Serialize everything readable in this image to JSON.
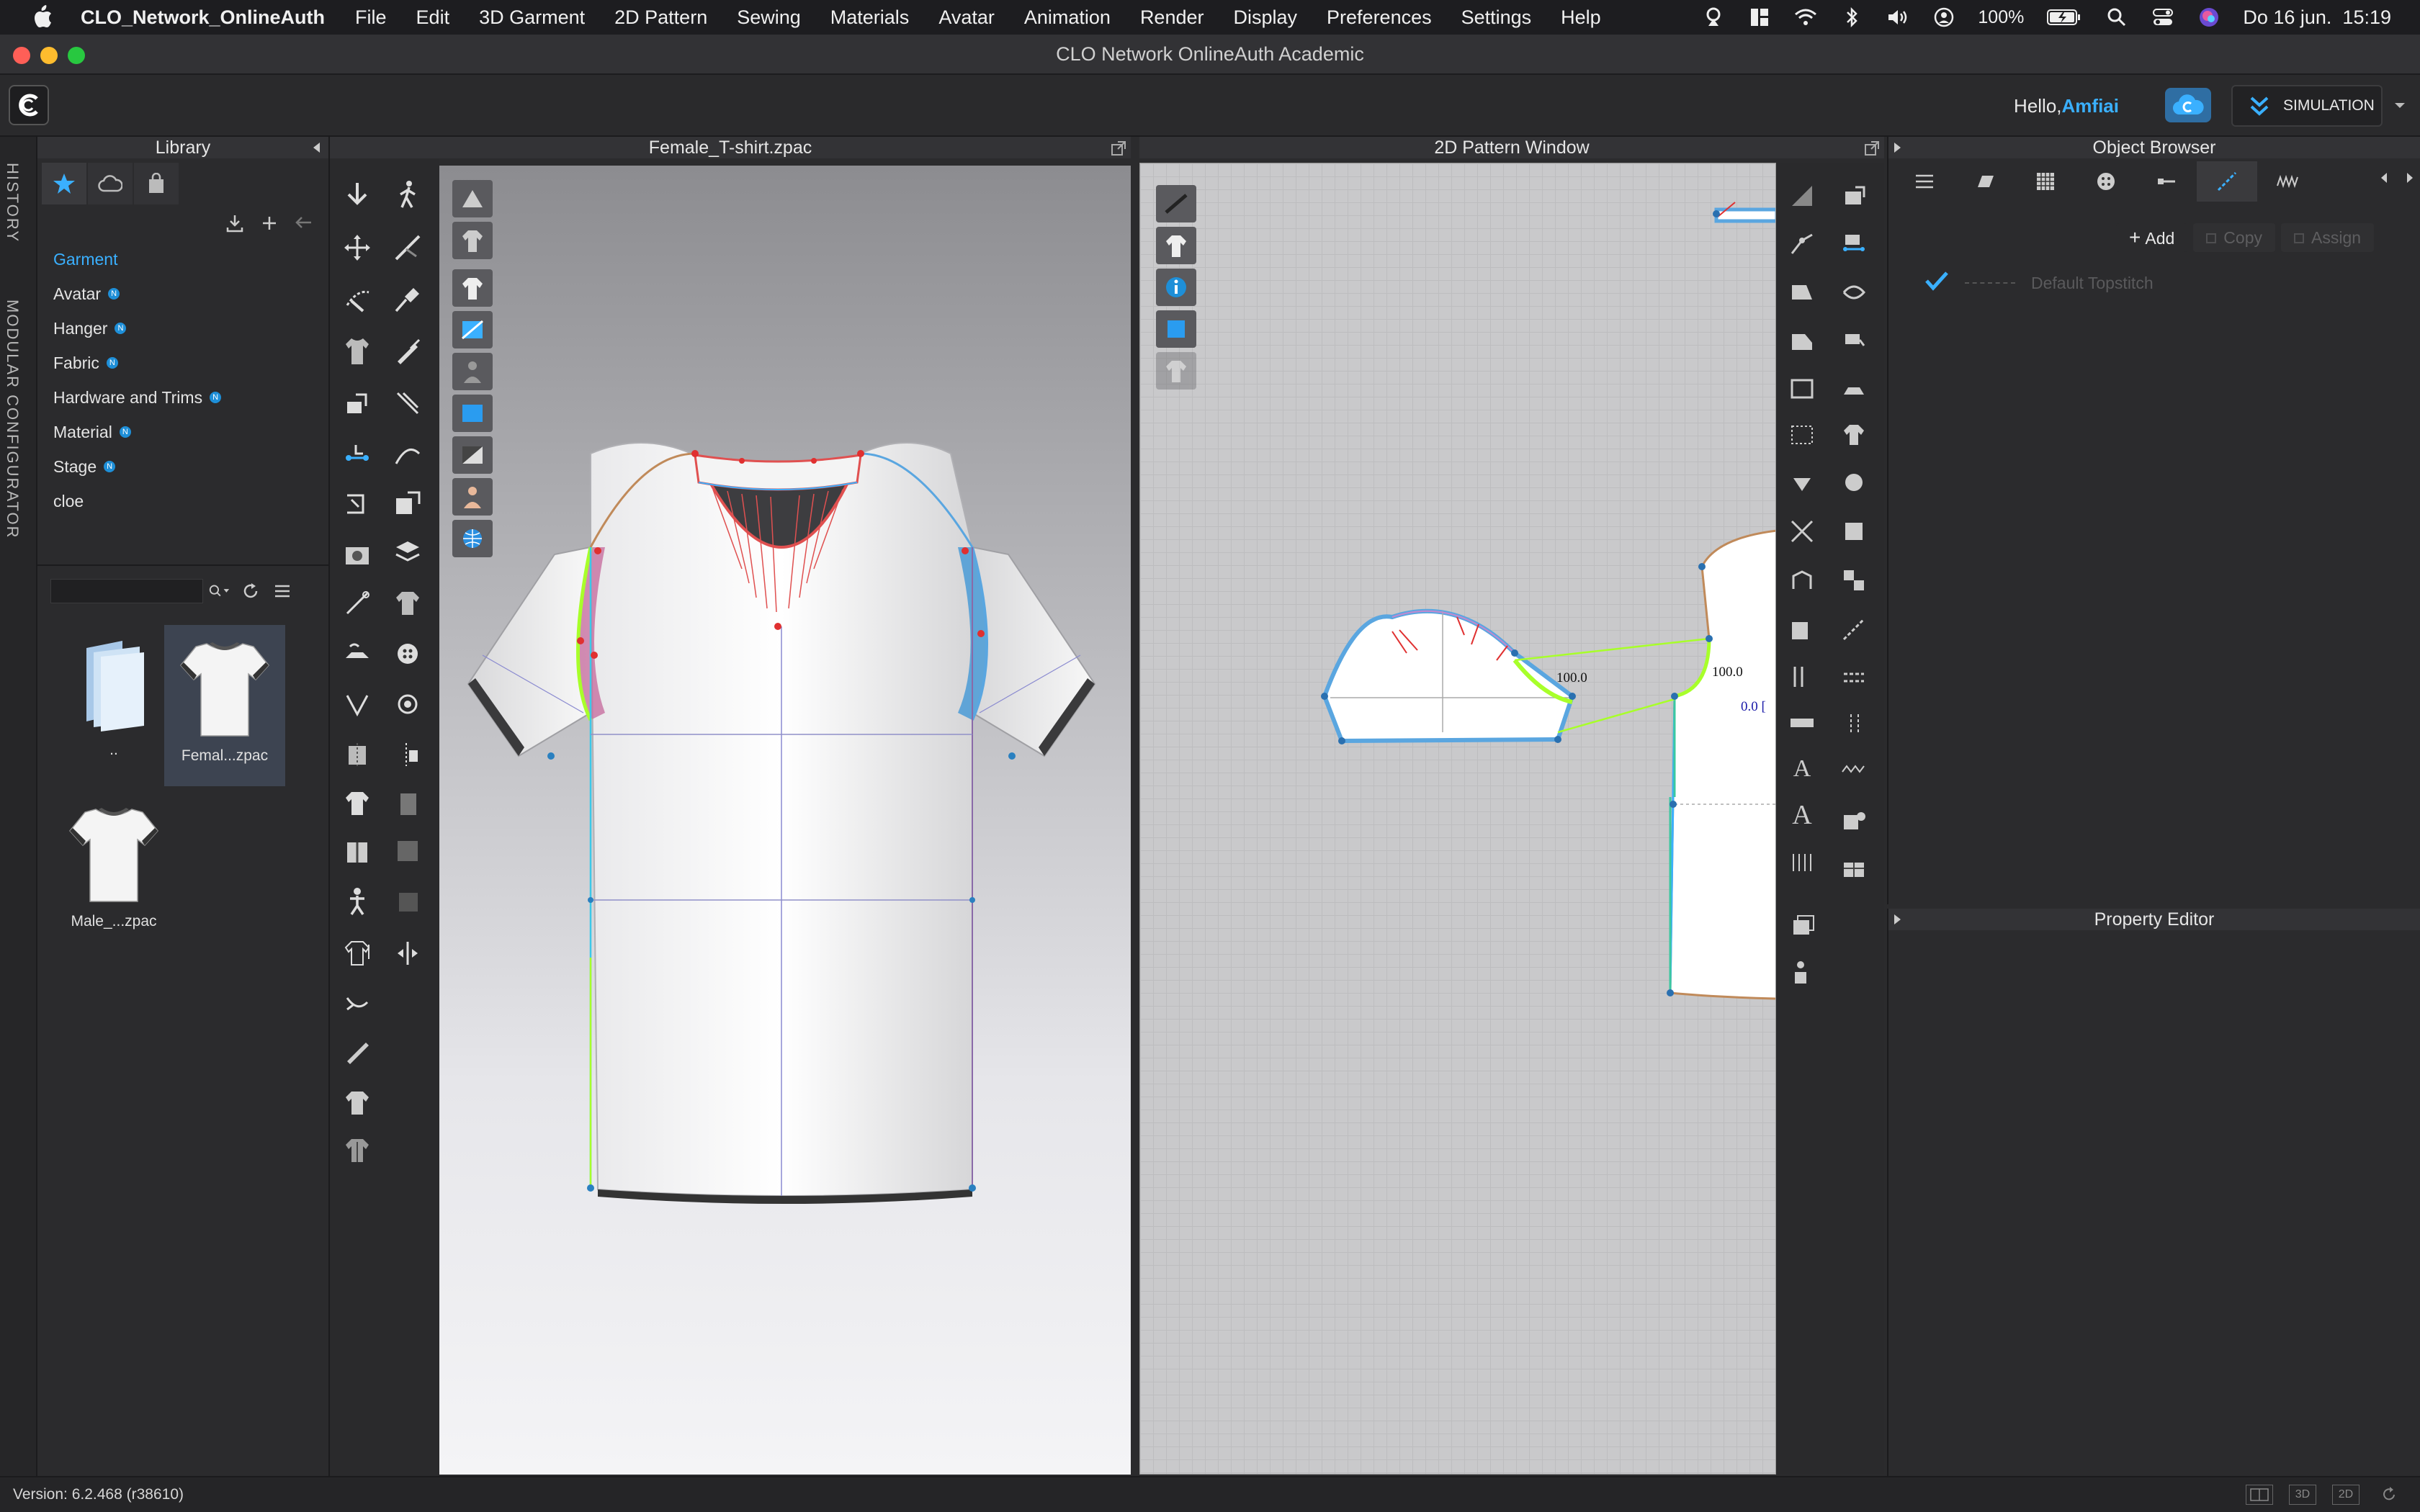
{
  "menubar": {
    "app_name": "CLO_Network_OnlineAuth",
    "items": [
      "File",
      "Edit",
      "3D Garment",
      "2D Pattern",
      "Sewing",
      "Materials",
      "Avatar",
      "Animation",
      "Render",
      "Display",
      "Preferences",
      "Settings",
      "Help"
    ],
    "battery": "100%",
    "datetime": "Do 16 jun.  15:19"
  },
  "window": {
    "title": "CLO Network OnlineAuth Academic"
  },
  "toolbar": {
    "hello_prefix": "Hello,",
    "username": "Amfiai",
    "simulation_label": "SIMULATION"
  },
  "sidetabs": {
    "history": "HISTORY",
    "modular": "MODULAR CONFIGURATOR"
  },
  "library": {
    "title": "Library",
    "items": [
      {
        "label": "Garment",
        "active": true
      },
      {
        "label": "Avatar",
        "badge": "N"
      },
      {
        "label": "Hanger",
        "badge": "N"
      },
      {
        "label": "Fabric",
        "badge": "N"
      },
      {
        "label": "Hardware and Trims",
        "badge": "N"
      },
      {
        "label": "Material",
        "badge": "N"
      },
      {
        "label": "Stage",
        "badge": "N"
      },
      {
        "label": "cloe"
      }
    ],
    "files": [
      {
        "caption": ".."
      },
      {
        "caption": "Femal...zpac",
        "selected": true
      },
      {
        "caption": "Male_...zpac"
      }
    ]
  },
  "window3d": {
    "title": "Female_T-shirt.zpac"
  },
  "window2d": {
    "title": "2D Pattern Window",
    "measure_a": "100.0",
    "measure_b": "100.0",
    "measure_c": "0.0 ["
  },
  "object_browser": {
    "title": "Object Browser",
    "add_label": "Add",
    "copy_label": "Copy",
    "assign_label": "Assign",
    "item_label": "Default Topstitch"
  },
  "property_editor": {
    "title": "Property Editor"
  },
  "status": {
    "version": "Version: 6.2.468 (r38610)"
  },
  "colors": {
    "accent": "#3ab0ff",
    "selection_blue": "#1e8fd8",
    "seam_green": "#a8ff2a",
    "pattern_blue": "#5aa6e0"
  }
}
